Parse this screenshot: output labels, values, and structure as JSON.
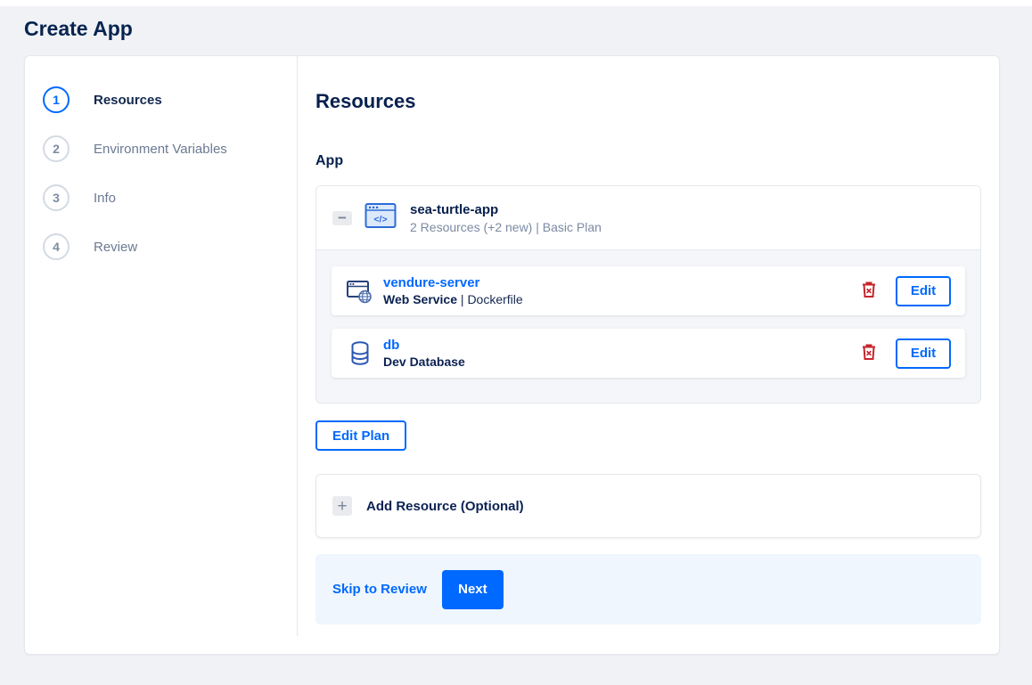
{
  "page": {
    "title": "Create App"
  },
  "stepper": {
    "steps": [
      {
        "number": "1",
        "label": "Resources"
      },
      {
        "number": "2",
        "label": "Environment Variables"
      },
      {
        "number": "3",
        "label": "Info"
      },
      {
        "number": "4",
        "label": "Review"
      }
    ]
  },
  "content": {
    "heading": "Resources",
    "section_label": "App",
    "app_card": {
      "name": "sea-turtle-app",
      "meta": "2 Resources (+2 new) | Basic Plan",
      "resources": [
        {
          "name": "vendure-server",
          "type": "Web Service",
          "separator": " | ",
          "detail": "Dockerfile",
          "edit_label": "Edit"
        },
        {
          "name": "db",
          "type": "Dev Database",
          "separator": "",
          "detail": "",
          "edit_label": "Edit"
        }
      ]
    },
    "edit_plan_label": "Edit Plan",
    "add_resource_label": "Add Resource (Optional)"
  },
  "footer": {
    "skip_label": "Skip to Review",
    "next_label": "Next"
  },
  "icons": {
    "collapse_glyph": "−",
    "add_glyph": "+"
  },
  "colors": {
    "accent_blue": "#0069ff",
    "navy_text": "#07204d",
    "muted_text": "#7b8aa3",
    "danger_red": "#c7242b",
    "footer_bg": "#eff6fd",
    "card_body_bg": "#f4f6f9"
  }
}
